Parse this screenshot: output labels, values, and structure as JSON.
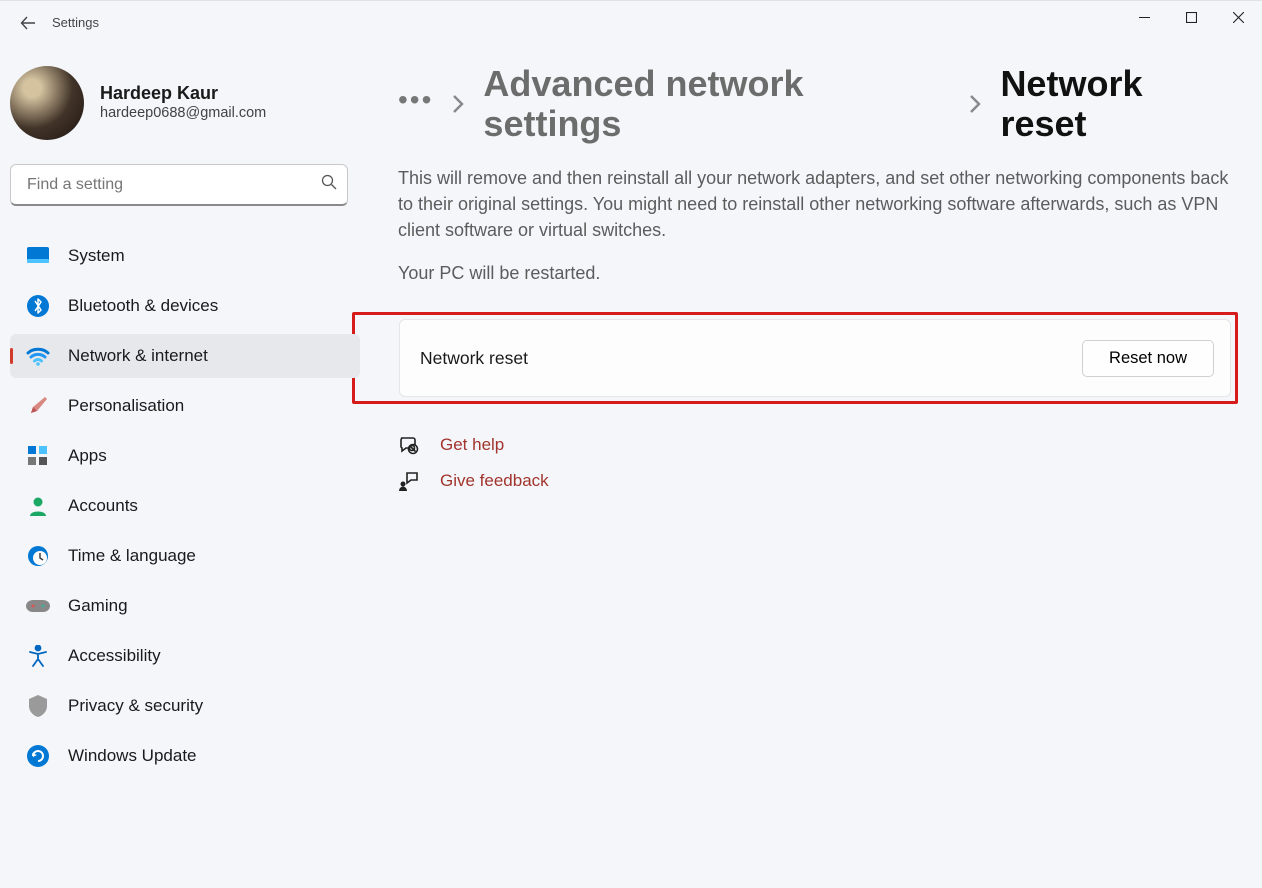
{
  "app_title": "Settings",
  "profile": {
    "name": "Hardeep Kaur",
    "email": "hardeep0688@gmail.com"
  },
  "search": {
    "placeholder": "Find a setting"
  },
  "sidebar": {
    "items": [
      {
        "label": "System"
      },
      {
        "label": "Bluetooth & devices"
      },
      {
        "label": "Network & internet"
      },
      {
        "label": "Personalisation"
      },
      {
        "label": "Apps"
      },
      {
        "label": "Accounts"
      },
      {
        "label": "Time & language"
      },
      {
        "label": "Gaming"
      },
      {
        "label": "Accessibility"
      },
      {
        "label": "Privacy & security"
      },
      {
        "label": "Windows Update"
      }
    ],
    "active_index": 2
  },
  "breadcrumb": {
    "parent": "Advanced network settings",
    "current": "Network reset"
  },
  "main": {
    "description": "This will remove and then reinstall all your network adapters, and set other networking components back to their original settings. You might need to reinstall other networking software afterwards, such as VPN client software or virtual switches.",
    "restart_note": "Your PC will be restarted.",
    "card_label": "Network reset",
    "reset_button": "Reset now"
  },
  "help": {
    "get_help": "Get help",
    "give_feedback": "Give feedback"
  }
}
